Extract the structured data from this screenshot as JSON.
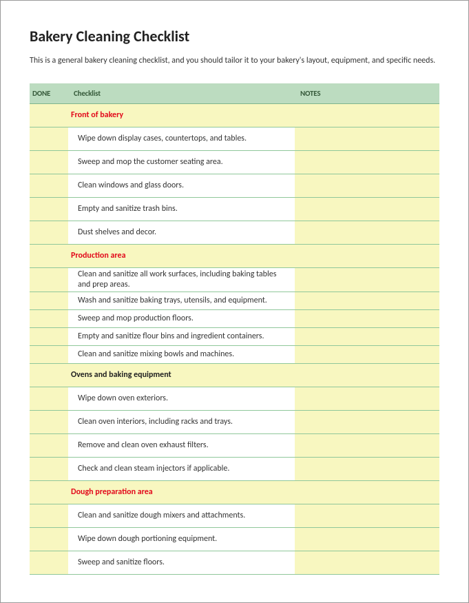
{
  "title": "Bakery Cleaning Checklist",
  "intro": "This is a general bakery cleaning checklist, and you should tailor it to your bakery's layout, equipment, and specific needs.",
  "headers": {
    "done": "DONE",
    "checklist": "Checklist",
    "notes": "NOTES"
  },
  "rows": [
    {
      "type": "section",
      "style": "red",
      "label": "Front of bakery"
    },
    {
      "type": "task",
      "label": "Wipe down display cases, countertops, and tables."
    },
    {
      "type": "task",
      "label": "Sweep and mop the customer seating area."
    },
    {
      "type": "task",
      "label": "Clean windows and glass doors."
    },
    {
      "type": "task",
      "label": "Empty and sanitize trash bins."
    },
    {
      "type": "task",
      "label": "Dust shelves and decor."
    },
    {
      "type": "section",
      "style": "red",
      "label": "Production area"
    },
    {
      "type": "task",
      "tight": true,
      "label": "Clean and sanitize all work surfaces, including baking tables and prep areas."
    },
    {
      "type": "task",
      "tight": true,
      "label": "Wash and sanitize baking trays, utensils, and equipment."
    },
    {
      "type": "task",
      "tight": true,
      "label": "Sweep and mop production floors."
    },
    {
      "type": "task",
      "tight": true,
      "label": "Empty and sanitize flour bins and ingredient containers."
    },
    {
      "type": "task",
      "tight": true,
      "label": "Clean and sanitize mixing bowls and machines."
    },
    {
      "type": "section",
      "style": "black",
      "label": "Ovens and baking equipment"
    },
    {
      "type": "task",
      "label": "Wipe down oven exteriors."
    },
    {
      "type": "task",
      "label": "Clean oven interiors, including racks and trays."
    },
    {
      "type": "task",
      "label": "Remove and clean oven exhaust filters."
    },
    {
      "type": "task",
      "label": "Check and clean steam injectors if applicable."
    },
    {
      "type": "section",
      "style": "red",
      "label": "Dough preparation area"
    },
    {
      "type": "task",
      "label": "Clean and sanitize dough mixers and attachments."
    },
    {
      "type": "task",
      "label": "Wipe down dough portioning equipment."
    },
    {
      "type": "task",
      "label": "Sweep and sanitize floors."
    }
  ]
}
